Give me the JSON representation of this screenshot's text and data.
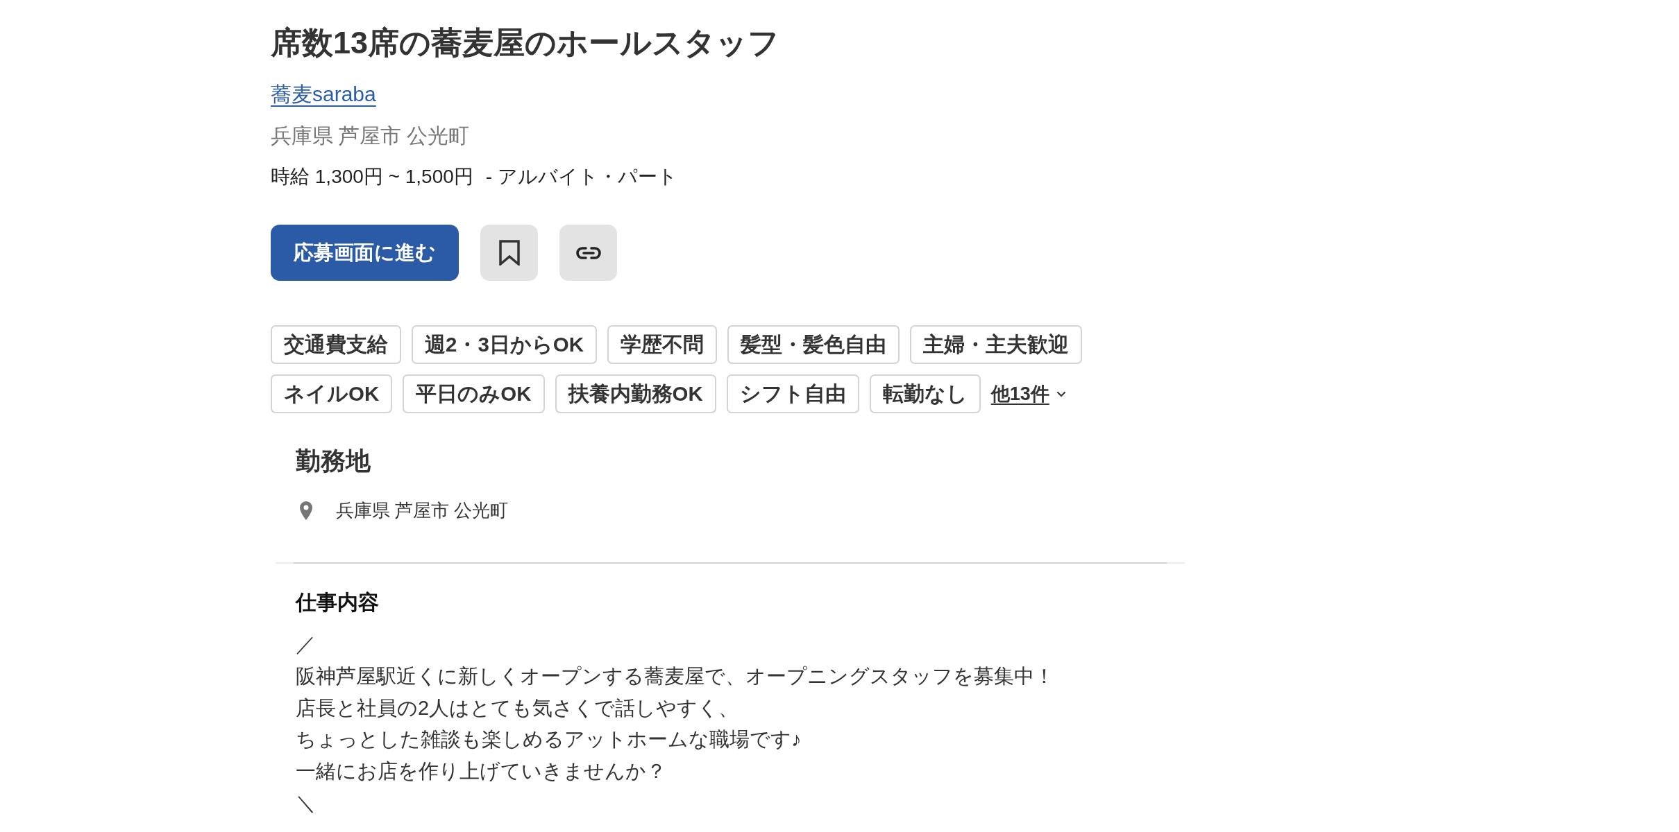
{
  "job": {
    "title": "席数13席の蕎麦屋のホールスタッフ",
    "company": "蕎麦saraba",
    "location": "兵庫県 芦屋市 公光町",
    "salary": "時給 1,300円 ~ 1,500円",
    "employment_type": "- アルバイト・パート"
  },
  "actions": {
    "apply_button": "応募画面に進む"
  },
  "tags": [
    "交通費支給",
    "週2・3日からOK",
    "学歴不問",
    "髪型・髪色自由",
    "主婦・主夫歓迎",
    "ネイルOK",
    "平日のみOK",
    "扶養内勤務OK",
    "シフト自由",
    "転勤なし"
  ],
  "more_tags": "他13件",
  "work_location": {
    "heading": "勤務地",
    "address": "兵庫県 芦屋市 公光町"
  },
  "job_description": {
    "heading": "仕事内容",
    "lines": [
      "／",
      "阪神芦屋駅近くに新しくオープンする蕎麦屋で、オープニングスタッフを募集中！",
      "店長と社員の2人はとても気さくで話しやすく、",
      "ちょっとした雑談も楽しめるアットホームな職場です♪",
      "一緒にお店を作り上げていきませんか？",
      "＼"
    ]
  }
}
